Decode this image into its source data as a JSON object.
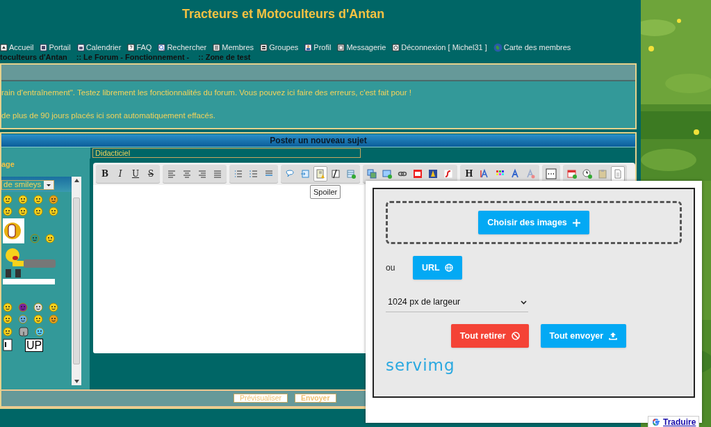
{
  "site_title": "Tracteurs et Motoculteurs d'Antan",
  "nav": [
    {
      "label": "Accueil"
    },
    {
      "label": "Portail"
    },
    {
      "label": "Calendrier"
    },
    {
      "label": "FAQ"
    },
    {
      "label": "Rechercher"
    },
    {
      "label": "Membres"
    },
    {
      "label": "Groupes"
    },
    {
      "label": "Profil"
    },
    {
      "label": "Messagerie"
    },
    {
      "label": "Déconnexion [ Michel31 ]"
    },
    {
      "label": "Carte des membres"
    }
  ],
  "breadcrumb": [
    "toculteurs d'Antan",
    ":: Le Forum - Fonctionnement -",
    ":: Zone de test"
  ],
  "forum_notice": [
    "rain d'entraînement\". Testez librement les fonctionnalités du forum. Vous pouvez ici faire des erreurs, c'est fait pour !",
    "de plus de 90 jours placés ici sont automatiquement effacés."
  ],
  "post_form": {
    "title": "Poster un nouveau sujet",
    "subject": "Didacticiel",
    "message_label": "age",
    "smileys": {
      "category": "de smileys",
      "up_sign": "UP"
    },
    "toolbar": [
      [
        {
          "kind": "letter",
          "label": "B",
          "hovered": false
        },
        {
          "kind": "letter",
          "label": "I",
          "hovered": false
        },
        {
          "kind": "letter",
          "label": "U",
          "hovered": false
        },
        {
          "kind": "letter",
          "label": "S",
          "hovered": false
        }
      ],
      [
        {
          "kind": "icon",
          "hovered": false
        },
        {
          "kind": "icon",
          "hovered": false
        },
        {
          "kind": "icon",
          "hovered": false
        },
        {
          "kind": "icon",
          "hovered": false
        }
      ],
      [
        {
          "kind": "icon",
          "hovered": false
        },
        {
          "kind": "icon",
          "hovered": false
        },
        {
          "kind": "icon",
          "hovered": false
        }
      ],
      [
        {
          "kind": "icon",
          "hovered": false
        },
        {
          "kind": "icon",
          "hovered": false
        },
        {
          "kind": "icon",
          "hovered": true
        },
        {
          "kind": "icon",
          "hovered": false
        },
        {
          "kind": "icon",
          "hovered": false
        }
      ],
      [
        {
          "kind": "icon",
          "hovered": false
        },
        {
          "kind": "icon",
          "hovered": false
        },
        {
          "kind": "icon",
          "hovered": false
        },
        {
          "kind": "icon",
          "hovered": false
        },
        {
          "kind": "icon",
          "hovered": false
        },
        {
          "kind": "icon",
          "hovered": false
        }
      ],
      [
        {
          "kind": "letter",
          "label": "H",
          "hovered": false
        },
        {
          "kind": "icon",
          "hovered": false
        },
        {
          "kind": "icon",
          "hovered": false
        },
        {
          "kind": "icon",
          "hovered": false
        },
        {
          "kind": "icon",
          "hovered": false
        }
      ],
      [
        {
          "kind": "icon",
          "hovered": false
        }
      ],
      [
        {
          "kind": "icon",
          "hovered": false
        },
        {
          "kind": "icon",
          "hovered": false
        },
        {
          "kind": "icon",
          "hovered": false
        },
        {
          "kind": "icon",
          "hovered": true
        }
      ]
    ],
    "tooltip": "Spoiler",
    "buttons": [
      "Prévisualiser",
      "Envoyer"
    ]
  },
  "upload_popup": {
    "choose_button": "Choisir des images",
    "or": "ou",
    "url_button": "URL",
    "size_select": "1024 px de largeur",
    "remove_all": "Tout retirer",
    "send_all": "Tout envoyer",
    "logo": "servimg"
  },
  "translate": "Traduire"
}
